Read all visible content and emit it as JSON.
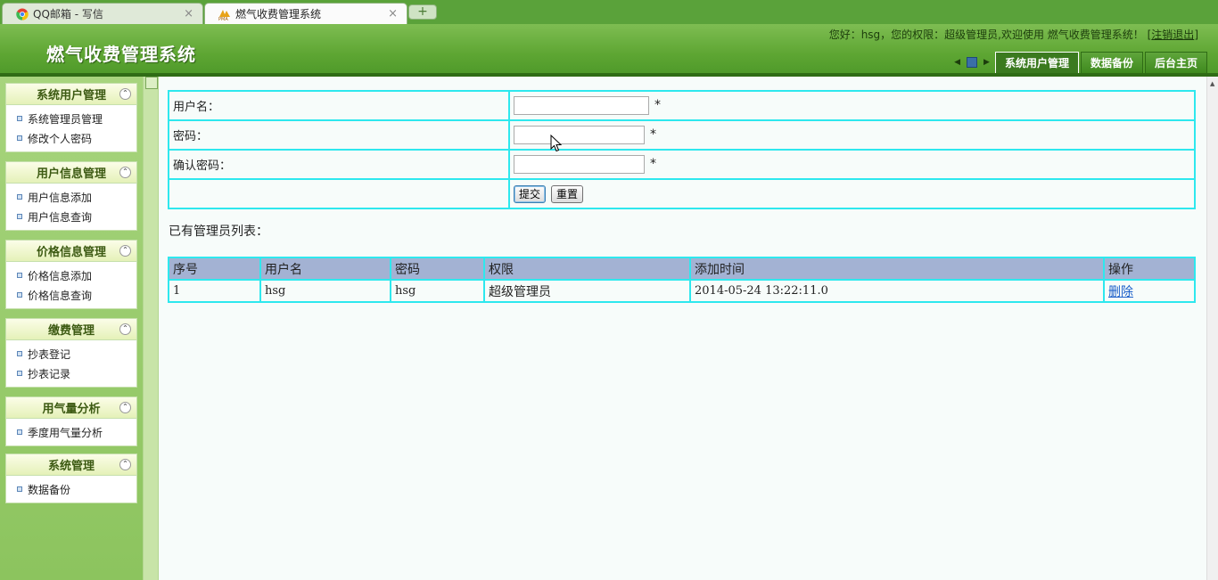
{
  "browser": {
    "tabs": [
      {
        "label": "QQ邮箱 - 写信",
        "close": "×"
      },
      {
        "label": "燃气收费管理系统",
        "close": "×"
      }
    ],
    "new_tab": "+"
  },
  "header": {
    "app_title": "燃气收费管理系统",
    "welcome_text": "您好：hsg，您的权限：超级管理员,欢迎使用 燃气收费管理系统！ [",
    "logout_label": "注销退出",
    "welcome_end": "]",
    "nav": [
      {
        "label": "系统用户管理"
      },
      {
        "label": "数据备份"
      },
      {
        "label": "后台主页"
      }
    ]
  },
  "sidebar": {
    "panels": [
      {
        "title": "系统用户管理",
        "items": [
          "系统管理员管理",
          "修改个人密码"
        ]
      },
      {
        "title": "用户信息管理",
        "items": [
          "用户信息添加",
          "用户信息查询"
        ]
      },
      {
        "title": "价格信息管理",
        "items": [
          "价格信息添加",
          "价格信息查询"
        ]
      },
      {
        "title": "缴费管理",
        "items": [
          "抄表登记",
          "抄表记录"
        ]
      },
      {
        "title": "用气量分析",
        "items": [
          "季度用气量分析"
        ]
      },
      {
        "title": "系统管理",
        "items": [
          "数据备份"
        ]
      }
    ]
  },
  "form": {
    "username_label": "用户名：",
    "password_label": "密码：",
    "confirm_label": "确认密码：",
    "required_mark": "*",
    "submit_label": "提交",
    "reset_label": "重置",
    "username_value": "",
    "password_value": "",
    "confirm_value": ""
  },
  "list": {
    "title": "已有管理员列表：",
    "columns": [
      "序号",
      "用户名",
      "密码",
      "权限",
      "添加时间",
      "操作"
    ],
    "rows": [
      {
        "index": "1",
        "username": "hsg",
        "password": "hsg",
        "role": "超级管理员",
        "added": "2014-05-24 13:22:11.0",
        "action": "删除"
      }
    ]
  },
  "colors": {
    "header_green": "#5ea633",
    "table_border": "#2ee8ee",
    "table_header": "#a3b2d3",
    "link": "#1a5ec9"
  }
}
